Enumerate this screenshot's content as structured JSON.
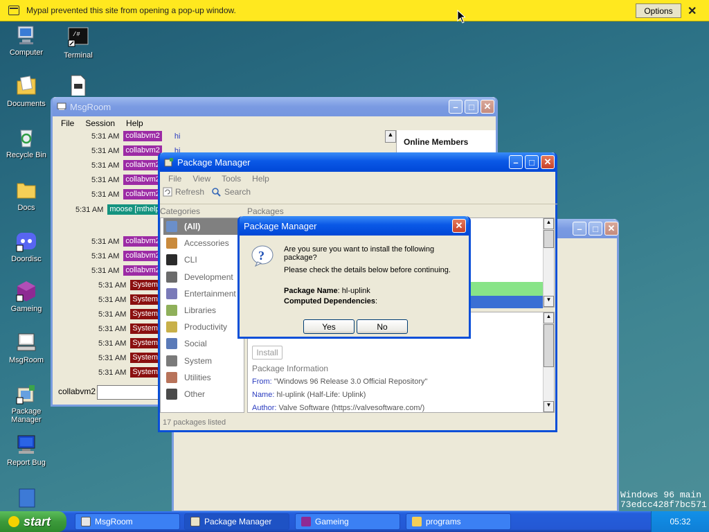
{
  "popup_bar": {
    "message": "Mypal prevented this site from opening a pop-up window.",
    "options_label": "Options",
    "close_glyph": "✕"
  },
  "desktop_icons": [
    {
      "label": "Computer",
      "icon": "computer-icon"
    },
    {
      "label": "Terminal",
      "icon": "terminal-icon"
    },
    {
      "label": "Documents",
      "icon": "documents-icon"
    },
    {
      "label": "Recycle Bin",
      "icon": "recycle-bin-icon"
    },
    {
      "label": "Docs",
      "icon": "folder-icon"
    },
    {
      "label": "Doordisc",
      "icon": "doordisc-icon"
    },
    {
      "label": "Gameing",
      "icon": "gameing-icon"
    },
    {
      "label": "MsgRoom",
      "icon": "msgroom-icon"
    },
    {
      "label": "Package Manager",
      "icon": "package-manager-icon"
    },
    {
      "label": "Report Bug",
      "icon": "report-bug-icon"
    }
  ],
  "msgroom": {
    "title": "MsgRoom",
    "menu": [
      "File",
      "Session",
      "Help"
    ],
    "online_members_label": "Online Members",
    "nickname": "collabvm2",
    "messages": [
      {
        "time": "5:31 AM",
        "user": "collabvm2",
        "type": "collab",
        "text": "hi"
      },
      {
        "time": "5:31 AM",
        "user": "collabvm2",
        "type": "collab",
        "text": "hi"
      },
      {
        "time": "5:31 AM",
        "user": "collabvm2",
        "type": "collab",
        "text": ""
      },
      {
        "time": "5:31 AM",
        "user": "collabvm2",
        "type": "collab",
        "text": ""
      },
      {
        "time": "5:31 AM",
        "user": "collabvm2",
        "type": "collab",
        "text": ""
      },
      {
        "time": "5:31 AM",
        "user": "moose [mthelp",
        "type": "moose",
        "text": ""
      },
      {
        "time": "5:31 AM",
        "user": "collabvm2",
        "type": "collab",
        "text": ""
      },
      {
        "time": "5:31 AM",
        "user": "collabvm2",
        "type": "collab",
        "text": ""
      },
      {
        "time": "5:31 AM",
        "user": "collabvm2",
        "type": "collab",
        "text": ""
      },
      {
        "time": "5:31 AM",
        "user": "System",
        "type": "system",
        "text": ""
      },
      {
        "time": "5:31 AM",
        "user": "System",
        "type": "system",
        "text": ""
      },
      {
        "time": "5:31 AM",
        "user": "System",
        "type": "system",
        "text": ""
      },
      {
        "time": "5:31 AM",
        "user": "System",
        "type": "system",
        "text": ""
      },
      {
        "time": "5:31 AM",
        "user": "System",
        "type": "system",
        "text": ""
      },
      {
        "time": "5:31 AM",
        "user": "System",
        "type": "system",
        "text": ""
      },
      {
        "time": "5:31 AM",
        "user": "System",
        "type": "system",
        "text": ""
      }
    ]
  },
  "package_manager": {
    "title": "Package Manager",
    "menu": [
      "File",
      "View",
      "Tools",
      "Help"
    ],
    "toolbar": {
      "refresh_label": "Refresh",
      "search_label": "Search"
    },
    "categories_header": "Categories",
    "packages_header": "Packages",
    "categories": [
      {
        "label": "(All)",
        "color": "#6b8fc9"
      },
      {
        "label": "Accessories",
        "color": "#c98a3c"
      },
      {
        "label": "CLI",
        "color": "#2b2b2b"
      },
      {
        "label": "Development",
        "color": "#6b6b6b"
      },
      {
        "label": "Entertainment",
        "color": "#7a7ab8"
      },
      {
        "label": "Libraries",
        "color": "#8fb05a"
      },
      {
        "label": "Productivity",
        "color": "#c8b049"
      },
      {
        "label": "Social",
        "color": "#5a7ab8"
      },
      {
        "label": "System",
        "color": "#7a7a7a"
      },
      {
        "label": "Utilities",
        "color": "#b8735a"
      },
      {
        "label": "Other",
        "color": "#4a4a4a"
      }
    ],
    "install_label": "Install",
    "package_info_header": "Package Information",
    "info": {
      "from_label": "From:",
      "from_value": "\"Windows 96 Release 3.0 Official Repository\"",
      "name_label": "Name:",
      "name_value": "hl-uplink (Half-Life: Uplink)",
      "author_label": "Author:",
      "author_value": "Valve Software (https://valvesoftware.com/)"
    },
    "status": "17 packages listed"
  },
  "dialog": {
    "title": "Package Manager",
    "question": "Are you sure you want to install the following package?",
    "details_note": "Please check the details below before continuing.",
    "package_name_label": "Package Name",
    "package_name_value": ": hl-uplink",
    "dependencies_label": "Computed Dependencies",
    "dependencies_value": ":",
    "yes_label": "Yes",
    "no_label": "No"
  },
  "taskbar": {
    "start_label": "start",
    "tasks": [
      {
        "label": "MsgRoom",
        "icon": "msgroom-icon"
      },
      {
        "label": "Package Manager",
        "icon": "package-manager-icon"
      },
      {
        "label": "Gameing",
        "icon": "gameing-icon"
      },
      {
        "label": "programs",
        "icon": "folder-icon"
      }
    ],
    "clock": "05:32"
  },
  "watermark": {
    "line1": "Windows 96 main",
    "line2": "73edcc428f7bc571"
  },
  "colors": {
    "popup_bar": "#ffe81f",
    "title_active": "#0a58e6",
    "collab_tag": "#9c2ba5",
    "moose_tag": "#14937f",
    "system_tag": "#8a0f0f",
    "selected_package_green": "#88e488",
    "selected_package_blue": "#3a6fd4"
  }
}
